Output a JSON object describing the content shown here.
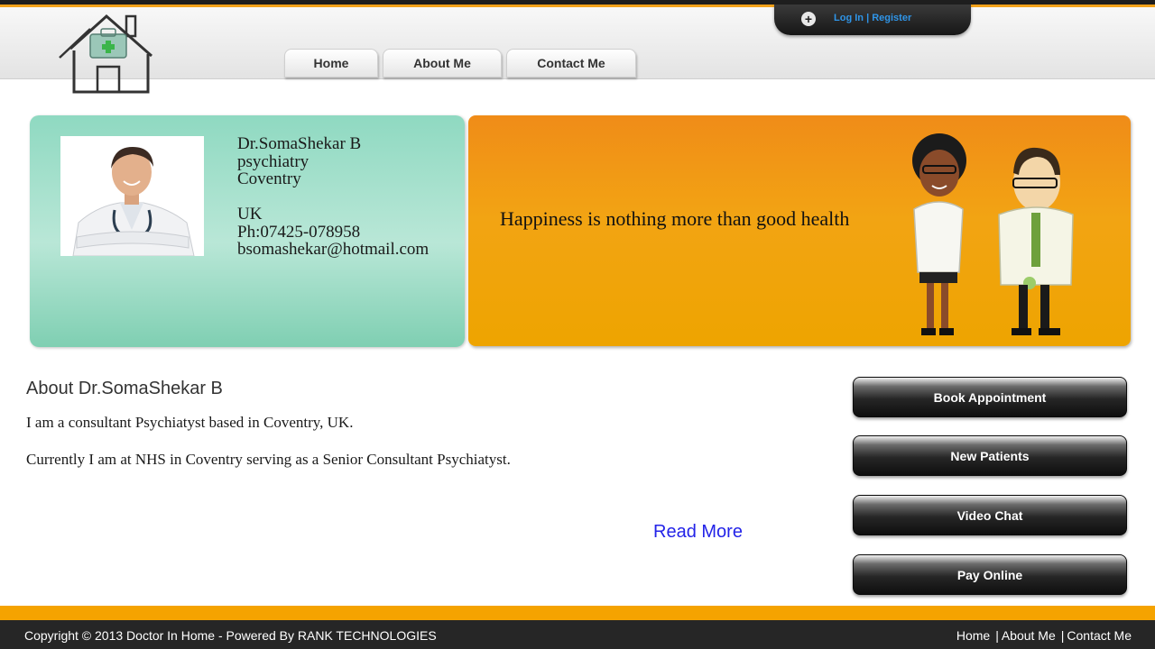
{
  "header": {
    "nav": [
      {
        "label": "Home"
      },
      {
        "label": "About Me"
      },
      {
        "label": "Contact Me"
      }
    ],
    "login_label": "Log In",
    "separator": "|",
    "register_label": "Register",
    "icon": "plus-circle-icon"
  },
  "profile": {
    "name": "Dr.SomaShekar B",
    "specialty": "psychiatry",
    "city": "Coventry",
    "country": "UK",
    "phone": "Ph:07425-078958",
    "email": "bsomashekar@hotmail.com"
  },
  "banner": {
    "quote": "Happiness is nothing more than good health"
  },
  "about": {
    "title": "About Dr.SomaShekar B",
    "para1": "I am a consultant Psychiatyst based in Coventry, UK.",
    "para2": "Currently I am at NHS in Coventry serving as a Senior Consultant Psychiatyst.",
    "read_more": "Read More"
  },
  "sidebar": {
    "buttons": [
      {
        "label": "Book Appointment"
      },
      {
        "label": "New Patients"
      },
      {
        "label": "Video Chat"
      },
      {
        "label": "Pay Online"
      }
    ]
  },
  "footer": {
    "copyright": "Copyright © 2013 Doctor In Home - Powered By RANK TECHNOLOGIES",
    "links": [
      {
        "label": "Home"
      },
      {
        "label": "About Me"
      },
      {
        "label": "Contact Me"
      }
    ],
    "separator": "|"
  },
  "colors": {
    "accent_orange": "#f5a300",
    "footer_bg": "#262626",
    "card_green": "#8fd9c1",
    "link_blue": "#2323e8"
  }
}
